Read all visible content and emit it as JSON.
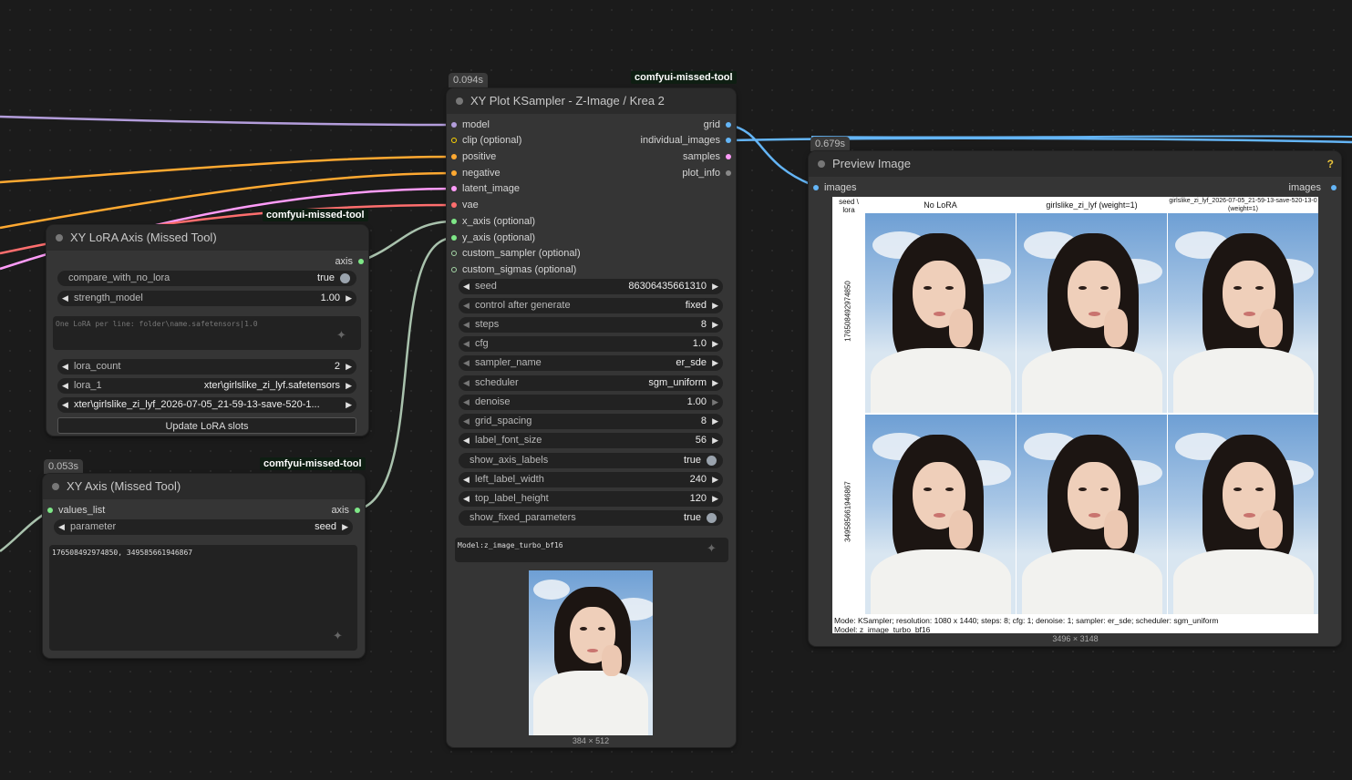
{
  "colors": {
    "model": "#b39ddb",
    "clip": "#ffd500",
    "conditioning": "#ffa931",
    "latent": "#ff9cf9",
    "vae": "#ff6e6e",
    "axis": "#7ee787",
    "image": "#64b5f6",
    "sampler": "#a5d6a7",
    "sigmas": "#cddc39",
    "string": "#888888"
  },
  "lora_node": {
    "title": "XY LoRA Axis (Missed Tool)",
    "source": "comfyui-missed-tool",
    "output": "axis",
    "compare_label": "compare_with_no_lora",
    "compare_value": "true",
    "strength_label": "strength_model",
    "strength_value": "1.00",
    "textarea_placeholder": "One LoRA per line: folder\\name.safetensors|1.0",
    "lora_count_label": "lora_count",
    "lora_count_value": "2",
    "lora1_label": "lora_1",
    "lora1_value": "xter\\girlslike_zi_lyf.safetensors",
    "lora2_value": "xter\\girlslike_zi_lyf_2026-07-05_21-59-13-save-520-1...",
    "update_button": "Update LoRA slots"
  },
  "xy_axis_node": {
    "time": "0.053s",
    "title": "XY Axis (Missed Tool)",
    "source": "comfyui-missed-tool",
    "input": "values_list",
    "output": "axis",
    "parameter_label": "parameter",
    "parameter_value": "seed",
    "values": "176508492974850, 349585661946867"
  },
  "ksampler_node": {
    "time": "0.094s",
    "title": "XY Plot KSampler - Z-Image / Krea 2",
    "source": "comfyui-missed-tool",
    "inputs": [
      "model",
      "clip (optional)",
      "positive",
      "negative",
      "latent_image",
      "vae",
      "x_axis (optional)",
      "y_axis (optional)",
      "custom_sampler (optional)",
      "custom_sigmas (optional)"
    ],
    "outputs": [
      "grid",
      "individual_images",
      "samples",
      "plot_info"
    ],
    "widgets": [
      {
        "label": "seed",
        "value": "86306435661310"
      },
      {
        "label": "control after generate",
        "value": "fixed"
      },
      {
        "label": "steps",
        "value": "8"
      },
      {
        "label": "cfg",
        "value": "1.0"
      },
      {
        "label": "sampler_name",
        "value": "er_sde"
      },
      {
        "label": "scheduler",
        "value": "sgm_uniform"
      },
      {
        "label": "denoise",
        "value": "1.00"
      },
      {
        "label": "grid_spacing",
        "value": "8"
      },
      {
        "label": "label_font_size",
        "value": "56"
      },
      {
        "label": "show_axis_labels",
        "value": "true"
      },
      {
        "label": "left_label_width",
        "value": "240"
      },
      {
        "label": "top_label_height",
        "value": "120"
      },
      {
        "label": "show_fixed_parameters",
        "value": "true"
      }
    ],
    "info_text": "Model:z_image_turbo_bf16",
    "preview_size": "384 × 512"
  },
  "preview_node": {
    "time": "0.679s",
    "title": "Preview Image",
    "help": "?",
    "input": "images",
    "output": "images",
    "corner_label": "seed \\ lora",
    "col_headers": [
      "No LoRA",
      "girlslike_zi_lyf (weight=1)",
      "girlslike_zi_lyf_2026-07-05_21-59-13-save-520-13-0 (weight=1)"
    ],
    "row_headers": [
      "176508492974850",
      "349585661946867"
    ],
    "footer_line1": "Mode: KSampler; resolution: 1080 x 1440; steps: 8; cfg: 1; denoise: 1; sampler: er_sde; scheduler: sgm_uniform",
    "footer_line2": "Model: z_image_turbo_bf16",
    "image_size": "3496 × 3148"
  }
}
